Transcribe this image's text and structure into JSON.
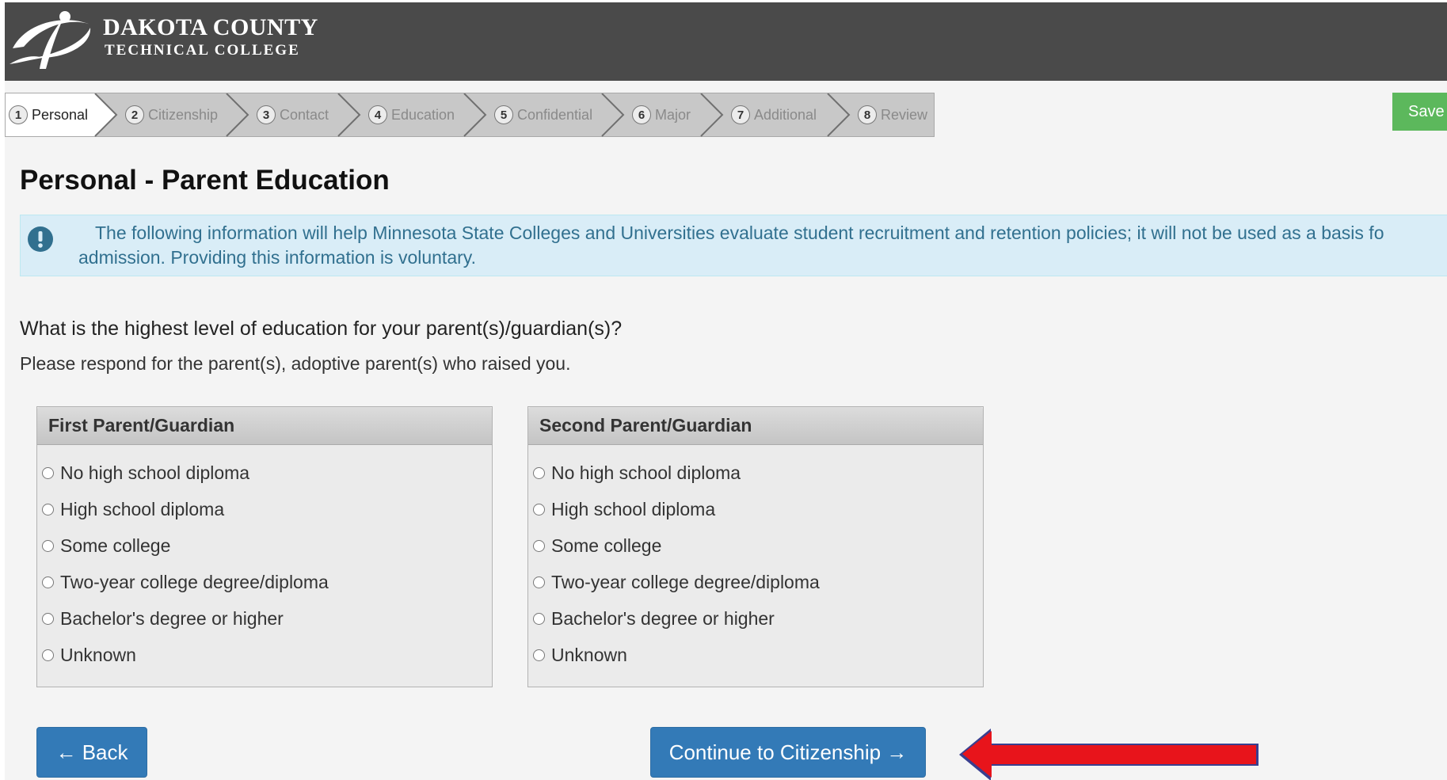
{
  "header": {
    "college_name_line1": "DAKOTA COUNTY",
    "college_name_line2": "TECHNICAL COLLEGE",
    "logo_icon": "swoosh-logo-icon"
  },
  "steps": [
    {
      "number": "1",
      "label": "Personal",
      "active": true
    },
    {
      "number": "2",
      "label": "Citizenship",
      "active": false
    },
    {
      "number": "3",
      "label": "Contact",
      "active": false
    },
    {
      "number": "4",
      "label": "Education",
      "active": false
    },
    {
      "number": "5",
      "label": "Confidential",
      "active": false
    },
    {
      "number": "6",
      "label": "Major",
      "active": false
    },
    {
      "number": "7",
      "label": "Additional",
      "active": false
    },
    {
      "number": "8",
      "label": "Review",
      "active": false
    }
  ],
  "save_button": "Save",
  "page_title": "Personal - Parent Education",
  "info": {
    "icon": "exclamation-circle-icon",
    "line1": "The following information will help Minnesota State Colleges and Universities evaluate student recruitment and retention policies; it will not be used as a basis fo",
    "line2": "admission. Providing this information is voluntary."
  },
  "question": "What is the highest level of education for your parent(s)/guardian(s)?",
  "subquestion": "Please respond for the parent(s), adoptive parent(s) who raised you.",
  "panels": [
    {
      "title": "First Parent/Guardian",
      "options": [
        "No high school diploma",
        "High school diploma",
        "Some college",
        "Two-year college degree/diploma",
        "Bachelor's degree or higher",
        "Unknown"
      ]
    },
    {
      "title": "Second Parent/Guardian",
      "options": [
        "No high school diploma",
        "High school diploma",
        "Some college",
        "Two-year college degree/diploma",
        "Bachelor's degree or higher",
        "Unknown"
      ]
    }
  ],
  "buttons": {
    "back": "← Back",
    "continue": "Continue to Citizenship →"
  },
  "colors": {
    "header_bg": "#4a4a4a",
    "primary": "#337ab7",
    "save_green": "#5cb85c",
    "info_bg": "#d9edf7",
    "info_text": "#31708f",
    "annotation_arrow": "#e8141b"
  }
}
